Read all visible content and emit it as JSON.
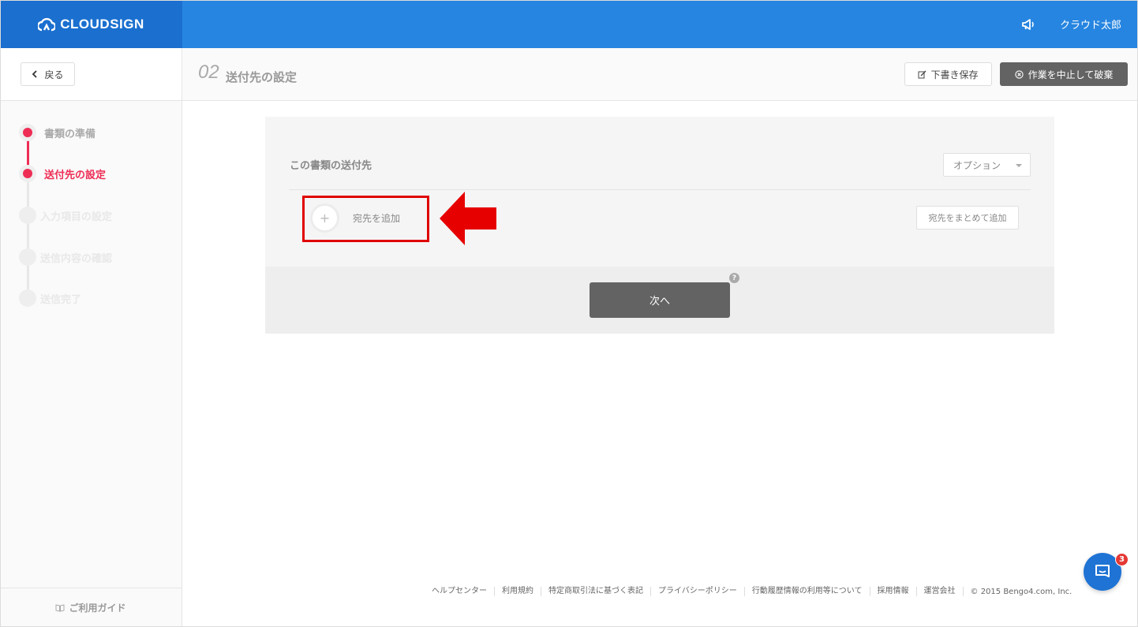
{
  "brand": {
    "name": "CLOUDSIGN",
    "color": "#1a6fcf",
    "bar_color": "#2685e0"
  },
  "header": {
    "username": "クラウド太郎",
    "notification_icon": "megaphone-icon"
  },
  "subheader": {
    "back_label": "戻る",
    "step_number": "02",
    "step_title": "送付先の設定",
    "draft_label": "下書き保存",
    "abort_label": "作業を中止して破棄"
  },
  "sidebar": {
    "steps": [
      {
        "label": "書類の準備",
        "state": "done"
      },
      {
        "label": "送付先の設定",
        "state": "current"
      },
      {
        "label": "入力項目の設定",
        "state": "todo"
      },
      {
        "label": "送信内容の確認",
        "state": "todo"
      },
      {
        "label": "送信完了",
        "state": "todo"
      }
    ],
    "guide_label": "ご利用ガイド",
    "accent_color": "#ee2d55"
  },
  "main": {
    "section_title": "この書類の送付先",
    "option_label": "オプション",
    "add_recipient_label": "宛先を追加",
    "bulk_add_label": "宛先をまとめて追加",
    "next_label": "次へ",
    "help_mark": "?"
  },
  "footer": {
    "links": [
      "ヘルプセンター",
      "利用規約",
      "特定商取引法に基づく表記",
      "プライバシーポリシー",
      "行動履歴情報の利用等について",
      "採用情報",
      "運営会社"
    ],
    "copyright": "© 2015 Bengo4.com, Inc."
  },
  "chat": {
    "badge_count": "3"
  }
}
